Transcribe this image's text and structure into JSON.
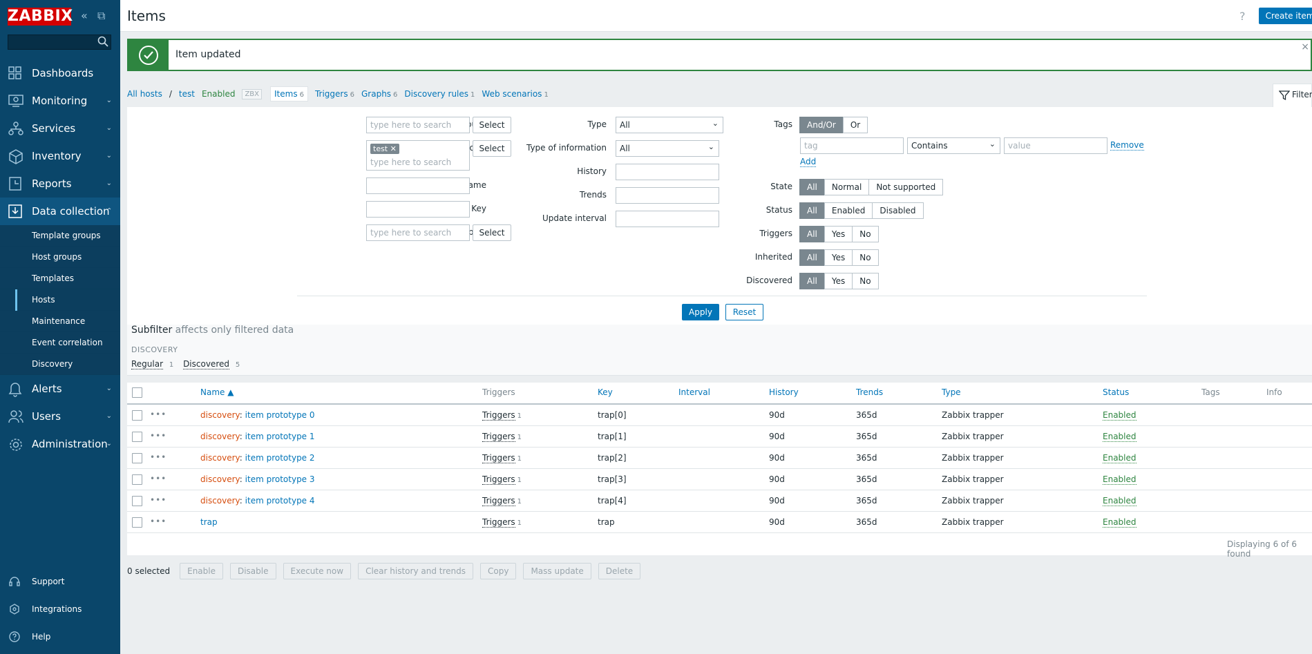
{
  "sidebar": {
    "logo": "ZABBIX",
    "collapse_icon": "«",
    "detach_icon": "⧉",
    "menu": [
      {
        "label": "Dashboards",
        "icon": "dashboards-icon"
      },
      {
        "label": "Monitoring",
        "icon": "monitoring-icon"
      },
      {
        "label": "Services",
        "icon": "services-icon"
      },
      {
        "label": "Inventory",
        "icon": "inventory-icon"
      },
      {
        "label": "Reports",
        "icon": "reports-icon"
      },
      {
        "label": "Data collection",
        "icon": "data-collection-icon"
      }
    ],
    "submenu": [
      "Template groups",
      "Host groups",
      "Templates",
      "Hosts",
      "Maintenance",
      "Event correlation",
      "Discovery"
    ],
    "menu2": [
      {
        "label": "Alerts",
        "icon": "alerts-icon"
      },
      {
        "label": "Users",
        "icon": "users-icon"
      },
      {
        "label": "Administration",
        "icon": "administration-icon"
      }
    ],
    "bottom": [
      "Support",
      "Integrations",
      "Help"
    ]
  },
  "header": {
    "title": "Items",
    "help": "?",
    "create_button": "Create item"
  },
  "message": {
    "text": "Item updated",
    "close": "×"
  },
  "breadcrumbs": {
    "all_hosts": "All hosts",
    "sep": "/",
    "host": "test",
    "enabled": "Enabled",
    "zbx": "ZBX",
    "items": "Items",
    "items_count": "6",
    "triggers": "Triggers",
    "triggers_count": "6",
    "graphs": "Graphs",
    "graphs_count": "6",
    "discovery": "Discovery rules",
    "discovery_count": "1",
    "web": "Web scenarios",
    "web_count": "1",
    "filter_tab": "Filter"
  },
  "filter": {
    "host_groups_label": "Host groups",
    "hosts_label": "Hosts",
    "name_label": "Name",
    "key_label": "Key",
    "value_mapping_label": "Value mapping",
    "search_placeholder": "type here to search",
    "select_label": "Select",
    "host_tag": "test",
    "host_tag_remove": "✕",
    "type_label": "Type",
    "type_value": "All",
    "type_info_label": "Type of information",
    "type_info_value": "All",
    "history_label": "History",
    "trends_label": "Trends",
    "update_interval_label": "Update interval",
    "tags_label": "Tags",
    "tags_andor": "And/Or",
    "tags_or": "Or",
    "tag_placeholder": "tag",
    "tag_operator": "Contains",
    "value_placeholder": "value",
    "remove": "Remove",
    "add": "Add",
    "state_label": "State",
    "state_options": [
      "All",
      "Normal",
      "Not supported"
    ],
    "status_label": "Status",
    "status_options": [
      "All",
      "Enabled",
      "Disabled"
    ],
    "triggers_label": "Triggers",
    "inherited_label": "Inherited",
    "discovered_label": "Discovered",
    "yn_options": [
      "All",
      "Yes",
      "No"
    ],
    "apply": "Apply",
    "reset": "Reset"
  },
  "subfilter": {
    "title": "Subfilter",
    "note": "affects only filtered data",
    "section": "DISCOVERY",
    "regular": "Regular",
    "regular_count": "1",
    "discovered": "Discovered",
    "discovered_count": "5"
  },
  "table": {
    "headers": {
      "name": "Name ▲",
      "triggers": "Triggers",
      "key": "Key",
      "interval": "Interval",
      "history": "History",
      "trends": "Trends",
      "type": "Type",
      "status": "Status",
      "tags": "Tags",
      "info": "Info"
    },
    "rows": [
      {
        "prefix": "discovery",
        "name": "item prototype 0",
        "triggers": "Triggers",
        "triggers_count": "1",
        "key": "trap[0]",
        "history": "90d",
        "trends": "365d",
        "type": "Zabbix trapper",
        "status": "Enabled"
      },
      {
        "prefix": "discovery",
        "name": "item prototype 1",
        "triggers": "Triggers",
        "triggers_count": "1",
        "key": "trap[1]",
        "history": "90d",
        "trends": "365d",
        "type": "Zabbix trapper",
        "status": "Enabled"
      },
      {
        "prefix": "discovery",
        "name": "item prototype 2",
        "triggers": "Triggers",
        "triggers_count": "1",
        "key": "trap[2]",
        "history": "90d",
        "trends": "365d",
        "type": "Zabbix trapper",
        "status": "Enabled"
      },
      {
        "prefix": "discovery",
        "name": "item prototype 3",
        "triggers": "Triggers",
        "triggers_count": "1",
        "key": "trap[3]",
        "history": "90d",
        "trends": "365d",
        "type": "Zabbix trapper",
        "status": "Enabled"
      },
      {
        "prefix": "discovery",
        "name": "item prototype 4",
        "triggers": "Triggers",
        "triggers_count": "1",
        "key": "trap[4]",
        "history": "90d",
        "trends": "365d",
        "type": "Zabbix trapper",
        "status": "Enabled"
      },
      {
        "prefix": "",
        "name": "trap",
        "triggers": "Triggers",
        "triggers_count": "1",
        "key": "trap",
        "history": "90d",
        "trends": "365d",
        "type": "Zabbix trapper",
        "status": "Enabled"
      }
    ],
    "footer": "Displaying 6 of 6 found"
  },
  "actions": {
    "selected": "0 selected",
    "buttons": [
      "Enable",
      "Disable",
      "Execute now",
      "Clear history and trends",
      "Copy",
      "Mass update",
      "Delete"
    ]
  }
}
